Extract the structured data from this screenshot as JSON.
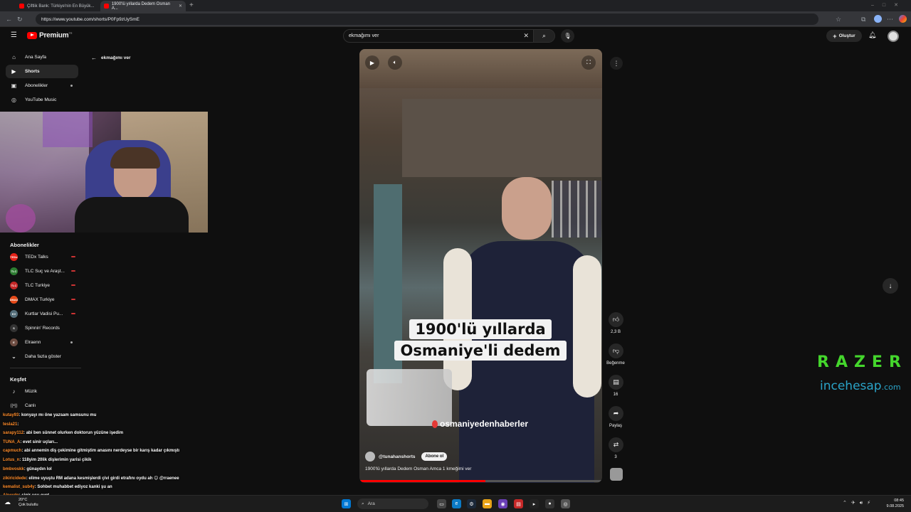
{
  "browser": {
    "tabs": [
      {
        "title": "Çiftlik Bank: Türkiye'nin En Büyük..."
      },
      {
        "title": "1900'lü yıllarda Dedem Osman A..."
      }
    ],
    "url": "https://www.youtube.com/shorts/P0Fp9zUySmE"
  },
  "header": {
    "logo_text": "Premium",
    "logo_sup": "TR",
    "search_value": "ekmağımı ver",
    "create_label": "Oluştur"
  },
  "sidebar": {
    "items": [
      {
        "label": "Ana Sayfa",
        "icon": "home-icon",
        "glyph": "⌂"
      },
      {
        "label": "Shorts",
        "icon": "shorts-icon",
        "glyph": "▶"
      },
      {
        "label": "Abonelikler",
        "icon": "subscriptions-icon",
        "glyph": "▣"
      },
      {
        "label": "YouTube Music",
        "icon": "music-circle-icon",
        "glyph": "◎"
      }
    ],
    "subs_heading": "Abonelikler",
    "subs": [
      {
        "label": "TEDx Talks",
        "color": "#e62117",
        "abbr": "TEDx"
      },
      {
        "label": "TLC Suç ve Araşt...",
        "color": "#2e7d32",
        "abbr": "TLC"
      },
      {
        "label": "TLC Turkiye",
        "color": "#c62828",
        "abbr": "TLC"
      },
      {
        "label": "DMAX Turkiye",
        "color": "#e64a19",
        "abbr": "DMAX"
      },
      {
        "label": "Kurtlar Vadisi Pu...",
        "color": "#546e7a",
        "abbr": "KV"
      },
      {
        "label": "Spinnin' Records",
        "color": "#333333",
        "abbr": "S"
      },
      {
        "label": "Elraenn",
        "color": "#6d4c41",
        "abbr": "E"
      },
      {
        "label": "Daha fazla göster",
        "color": "",
        "abbr": "⌄"
      }
    ],
    "explore_heading": "Keşfet",
    "explore": [
      {
        "label": "Müzik",
        "glyph": "♪"
      },
      {
        "label": "Canlı",
        "glyph": "((•))"
      }
    ]
  },
  "back_link": "ekmağımı ver",
  "video": {
    "caption_line1": "1900'lü yıllarda",
    "caption_line2": "Osmaniye'li dedem",
    "watermark": "osmaniyedenhaberler",
    "channel": "@tunahanshorts",
    "subscribe_label": "Abone ol",
    "title": "1900'lü yıllarda Dedem Osman Amca  1 kmeğimi ver"
  },
  "actions": {
    "likes": "2,3 B",
    "dislike_label": "Beğenme",
    "comments": "16",
    "share_label": "Paylaş",
    "remix_count": "3"
  },
  "chat": [
    {
      "user": "kutay93",
      "msg": ": konyayı mı öne yazsam samsunu mu"
    },
    {
      "user": "tesla21",
      "msg": ":"
    },
    {
      "user": "sarapy112",
      "msg": ": abi ben sünnet olurken doktorun yüzüne işedim"
    },
    {
      "user": "TUNA_A",
      "msg": ": evet sinir uçları..."
    },
    {
      "user": "capmuch",
      "msg": ": abi annemin diş çekimine gitmiştim anasını nerdeyse bir karış kadar çıkmıştı"
    },
    {
      "user": "Lotus_n",
      "msg": ": 118yim 20lik dişlerimin yarisi çikik"
    },
    {
      "user": "bmbvoskk",
      "msg": ": günaydın lol"
    },
    {
      "user": "zikiricidede",
      "msg": ": elime uyuştu RM adana kesmişlerdi çivi girdi etrafını oydu ah 😊 @rraenee"
    },
    {
      "user": "kemalist_sub4y",
      "msg": ": Sohbet muhabbet ediyoz kanki şu an"
    },
    {
      "user": "Alperdg",
      "msg": ": sinir ucu evet"
    }
  ],
  "overlay": {
    "razer": "RAZER",
    "ince": "incehesap",
    "ince_tld": ".com"
  },
  "taskbar": {
    "search_label": "Ara",
    "weather_temp": "20°C",
    "weather_desc": "Çok bulutlu",
    "time": "08:45",
    "date": "9.08.2025"
  }
}
